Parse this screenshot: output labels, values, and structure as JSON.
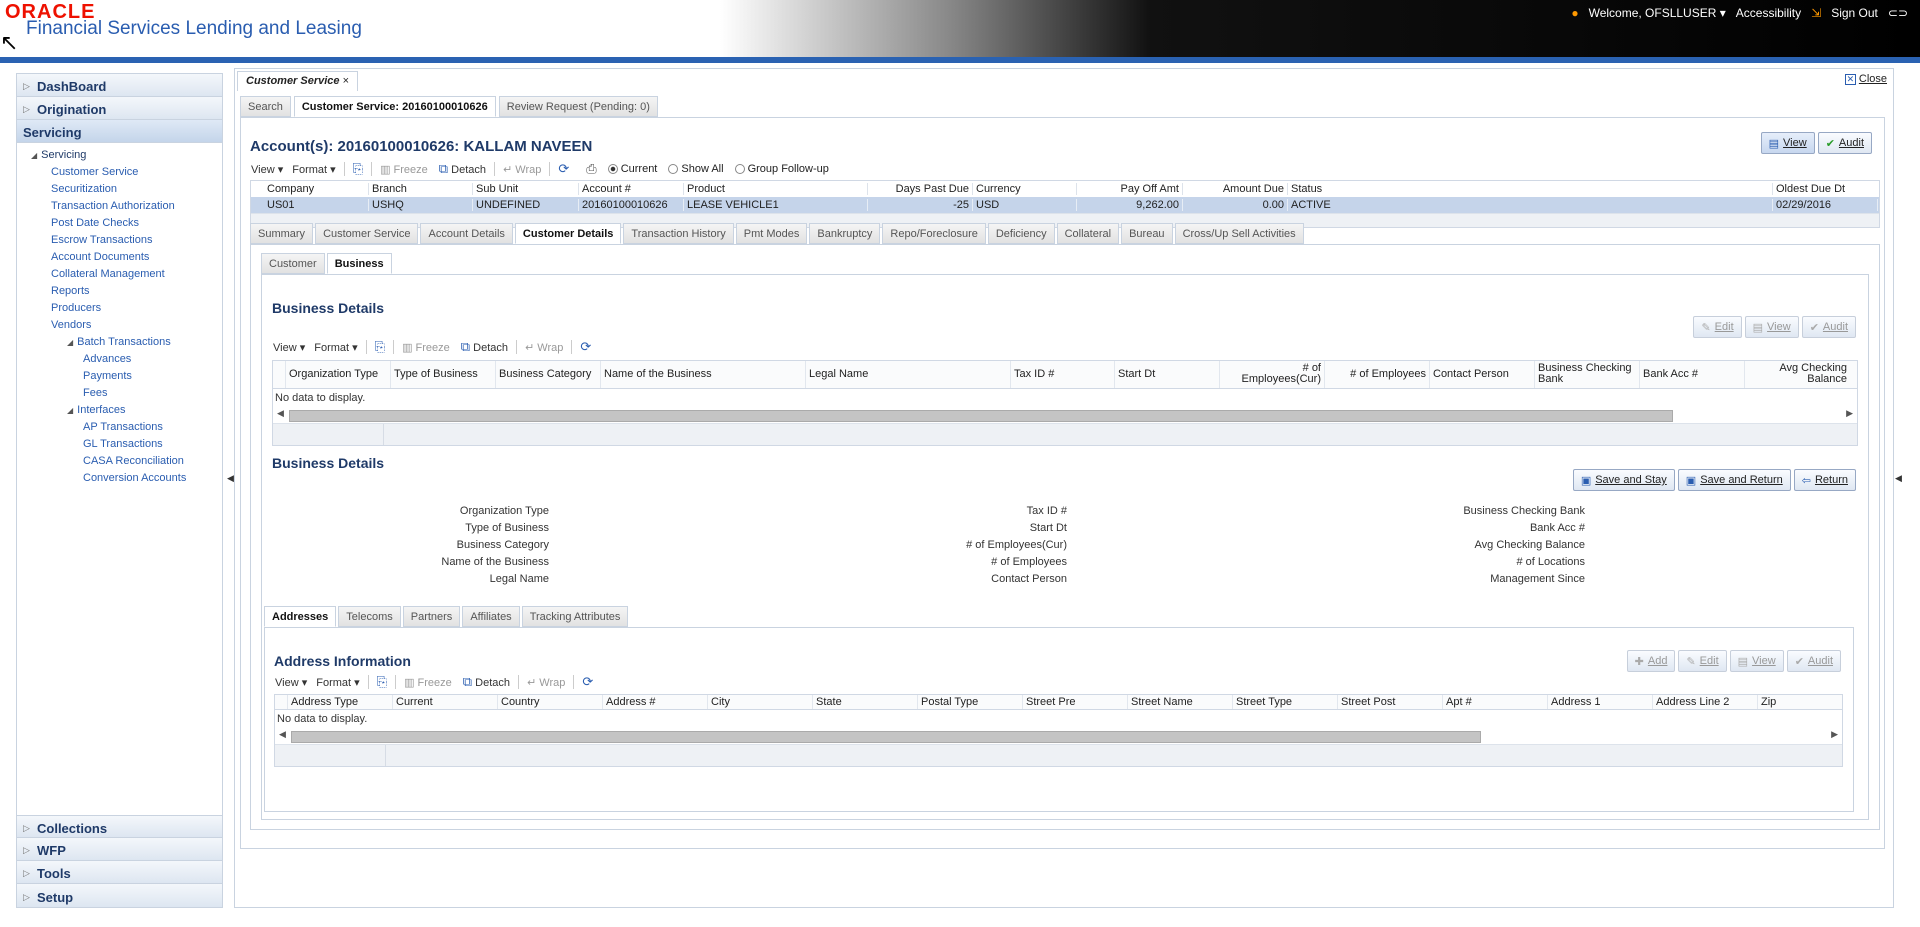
{
  "header": {
    "logo": "ORACLE",
    "product": "Financial Services Lending and Leasing",
    "welcome": "Welcome, OFSLLUSER",
    "accessibility": "Accessibility",
    "sign_out": "Sign Out"
  },
  "sidebar": {
    "top_sections": [
      "DashBoard",
      "Origination",
      "Servicing"
    ],
    "tree_root": "Servicing",
    "servicing_items": [
      "Customer Service",
      "Securitization",
      "Transaction Authorization",
      "Post Date Checks",
      "Escrow Transactions",
      "Account Documents",
      "Collateral Management",
      "Reports",
      "Producers",
      "Vendors"
    ],
    "batch_label": "Batch Transactions",
    "batch_items": [
      "Advances",
      "Payments",
      "Fees"
    ],
    "interfaces_label": "Interfaces",
    "interfaces_items": [
      "AP Transactions",
      "GL Transactions",
      "CASA Reconciliation",
      "Conversion Accounts"
    ],
    "bottom_sections": [
      "Collections",
      "WFP",
      "Tools",
      "Setup"
    ]
  },
  "doc_tab": {
    "label": "Customer Service",
    "close": "×"
  },
  "close_label": "Close",
  "subtabs": [
    "Search",
    "Customer Service: 20160100010626",
    "Review Request (Pending: 0)"
  ],
  "account": {
    "title": "Account(s): 20160100010626: KALLAM NAVEEN",
    "view_button": "View",
    "audit_button": "Audit",
    "toolbar": {
      "view": "View",
      "format": "Format",
      "freeze": "Freeze",
      "detach": "Detach",
      "wrap": "Wrap"
    },
    "radios": [
      "Current",
      "Show All",
      "Group Follow-up"
    ],
    "columns": [
      "Company",
      "Branch",
      "Sub Unit",
      "Account #",
      "Product",
      "Days Past Due",
      "Currency",
      "Pay Off Amt",
      "Amount Due",
      "Status",
      "Oldest Due Dt"
    ],
    "row": [
      "US01",
      "USHQ",
      "UNDEFINED",
      "20160100010626",
      "LEASE VEHICLE1",
      "-25",
      "USD",
      "9,262.00",
      "0.00",
      "ACTIVE",
      "02/29/2016"
    ]
  },
  "section_tabs": [
    "Summary",
    "Customer Service",
    "Account Details",
    "Customer Details",
    "Transaction History",
    "Pmt Modes",
    "Bankruptcy",
    "Repo/Foreclosure",
    "Deficiency",
    "Collateral",
    "Bureau",
    "Cross/Up Sell Activities"
  ],
  "inner_tabs": [
    "Customer",
    "Business"
  ],
  "business_grid": {
    "title": "Business Details",
    "buttons": {
      "edit": "Edit",
      "view": "View",
      "audit": "Audit"
    },
    "columns": [
      "Organization Type",
      "Type of Business",
      "Business Category",
      "Name of the Business",
      "Legal Name",
      "Tax ID #",
      "Start Dt",
      "# of Employees(Cur)",
      "# of Employees",
      "Contact Person",
      "Business Checking Bank",
      "Bank Acc #",
      "Avg Checking Balance"
    ],
    "no_data": "No data to display."
  },
  "business_form": {
    "title": "Business Details",
    "save_stay": "Save and Stay",
    "save_return": "Save and Return",
    "return": "Return",
    "col1": [
      "Organization Type",
      "Type of Business",
      "Business Category",
      "Name of the Business",
      "Legal Name"
    ],
    "col2": [
      "Tax ID #",
      "Start Dt",
      "# of Employees(Cur)",
      "# of Employees",
      "Contact Person"
    ],
    "col3": [
      "Business Checking Bank",
      "Bank Acc #",
      "Avg Checking Balance",
      "# of Locations",
      "Management Since"
    ]
  },
  "address_tabs": [
    "Addresses",
    "Telecoms",
    "Partners",
    "Affiliates",
    "Tracking Attributes"
  ],
  "address_grid": {
    "title": "Address Information",
    "buttons": {
      "add": "Add",
      "edit": "Edit",
      "view": "View",
      "audit": "Audit"
    },
    "columns": [
      "Address Type",
      "Current",
      "Country",
      "Address #",
      "City",
      "State",
      "Postal Type",
      "Street Pre",
      "Street Name",
      "Street Type",
      "Street Post",
      "Apt #",
      "Address 1",
      "Address Line 2",
      "Zip"
    ],
    "no_data": "No data to display."
  },
  "colors": {
    "brand_red": "#e10000",
    "accent_blue": "#2a62b2",
    "heading_blue": "#1f3a68",
    "selected_row": "#c5d4ea"
  }
}
